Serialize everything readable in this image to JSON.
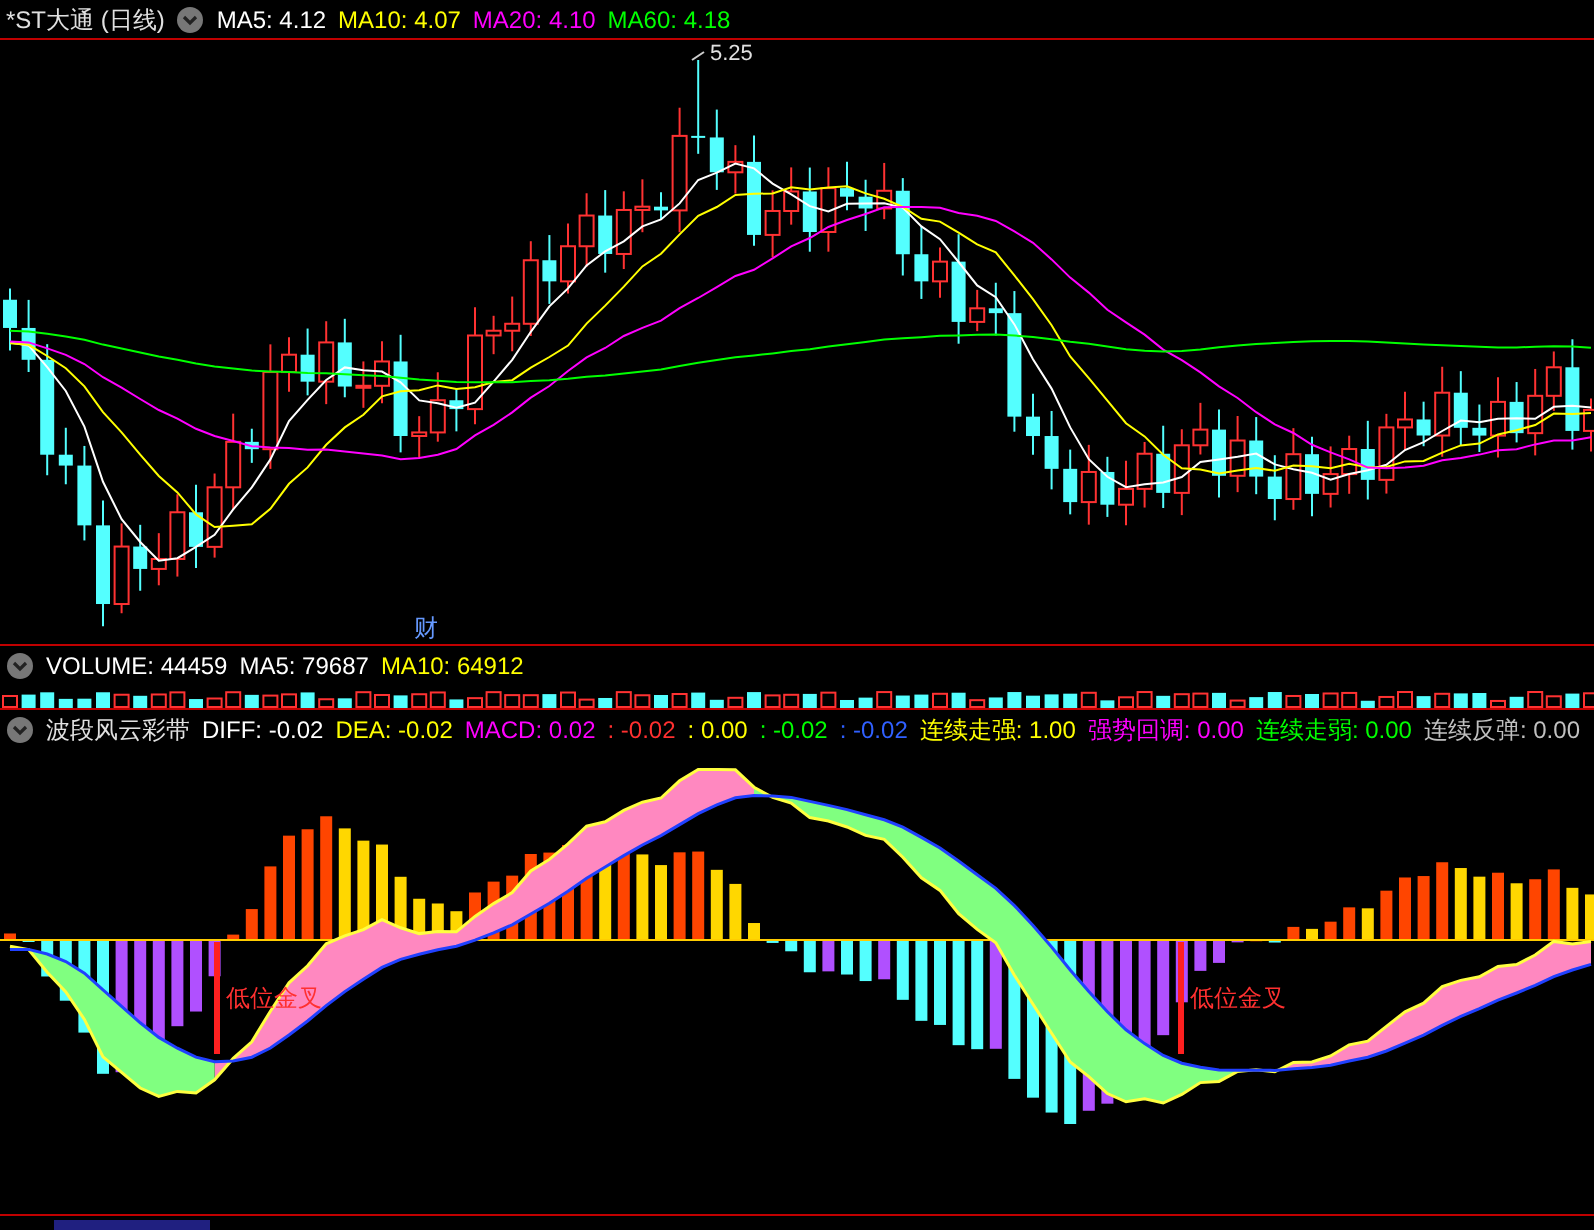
{
  "price_panel": {
    "title": "*ST大通 (日线)",
    "legend": [
      {
        "text": "MA5: 4.12",
        "color": "#ffffff"
      },
      {
        "text": "MA10: 4.07",
        "color": "#ffff00"
      },
      {
        "text": "MA20: 4.10",
        "color": "#ff00ff"
      },
      {
        "text": "MA60: 4.18",
        "color": "#00ff00"
      }
    ],
    "high_label": "5.25",
    "event_marker": "财"
  },
  "volume_panel": {
    "legend": [
      {
        "text": "VOLUME: 44459",
        "color": "#ffffff"
      },
      {
        "text": "MA5: 79687",
        "color": "#ffffff"
      },
      {
        "text": "MA10: 64912",
        "color": "#ffff00"
      }
    ]
  },
  "indicator_panel": {
    "title": "波段风云彩带",
    "legend": [
      {
        "text": "DIFF: -0.02",
        "color": "#ffffff"
      },
      {
        "text": "DEA: -0.02",
        "color": "#ffff00"
      },
      {
        "text": "MACD: 0.02",
        "color": "#ff00ff"
      },
      {
        "text": ": -0.02",
        "color": "#ff3030"
      },
      {
        "text": ": 0.00",
        "color": "#ffff00"
      },
      {
        "text": ": -0.02",
        "color": "#00ff00"
      },
      {
        "text": ": -0.02",
        "color": "#3060ff"
      },
      {
        "text": "连续走强: 1.00",
        "color": "#ffff00"
      },
      {
        "text": "强势回调: 0.00",
        "color": "#ff00ff"
      },
      {
        "text": "连续走弱: 0.00",
        "color": "#00ff00"
      },
      {
        "text": "连续反弹: 0.00",
        "color": "#c0c0c0"
      }
    ],
    "annotations": [
      {
        "text": "低位金叉"
      },
      {
        "text": "低位金叉"
      }
    ]
  }
}
